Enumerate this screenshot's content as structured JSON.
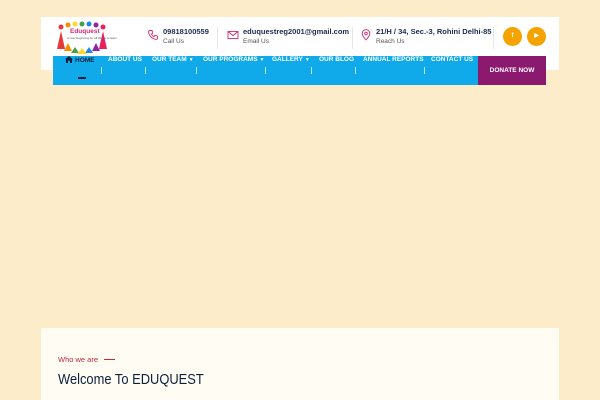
{
  "header": {
    "logo": {
      "title": "Eduquest",
      "tagline": "A new beginning for all things to learn"
    },
    "contacts": [
      {
        "icon": "phone-icon",
        "value": "09818100559",
        "label": "Call Us"
      },
      {
        "icon": "mail-icon",
        "value": "eduquestreg2001@gmail.com",
        "label": "Email Us"
      },
      {
        "icon": "location-pin-icon",
        "value": "21/H / 34, Sec.-3, Rohini Delhi-85",
        "label": "Reach Us"
      }
    ],
    "social": [
      {
        "icon": "facebook-icon",
        "glyph": "f"
      },
      {
        "icon": "youtube-icon",
        "glyph": "▶"
      }
    ]
  },
  "nav": {
    "items": [
      {
        "label": "HOME",
        "active": true
      },
      {
        "label": "ABOUT US"
      },
      {
        "label": "OUR TEAM",
        "dropdown": true
      },
      {
        "label": "OUR PROGRAMS",
        "dropdown": true
      },
      {
        "label": "GALLERY",
        "dropdown": true
      },
      {
        "label": "OUR BLOG"
      },
      {
        "label": "ANNUAL REPORTS"
      },
      {
        "label": "CONTACT US"
      }
    ],
    "cta": "DONATE NOW"
  },
  "section": {
    "eyebrow": "Who we are",
    "heading": "Welcome To EDUQUEST"
  },
  "colors": {
    "page_bg": "#fcecc9",
    "nav_bg": "#10a9ea",
    "donate_bg": "#8b1a6e",
    "accent": "#d12a6e",
    "social_bg": "#f5a300",
    "heading": "#0c1f3d"
  }
}
